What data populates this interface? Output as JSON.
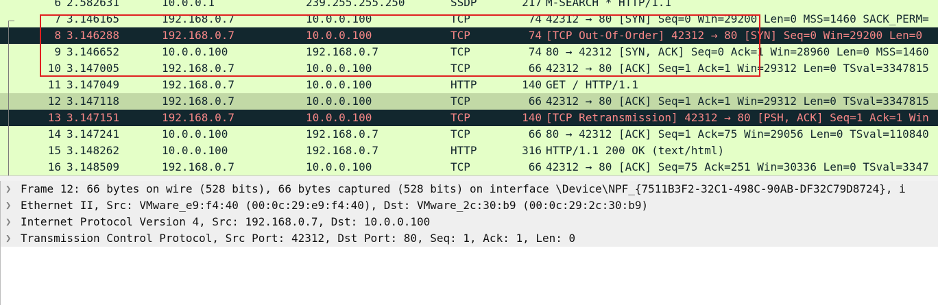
{
  "packets": [
    {
      "no": "6",
      "time": "2.582631",
      "src": "10.0.0.1",
      "dst": "239.255.255.250",
      "proto": "SSDP",
      "len": "217",
      "info": "M-SEARCH * HTTP/1.1",
      "style": "normal"
    },
    {
      "no": "7",
      "time": "3.146165",
      "src": "192.168.0.7",
      "dst": "10.0.0.100",
      "proto": "TCP",
      "len": "74",
      "info": "42312 → 80 [SYN] Seq=0 Win=29200 Len=0 MSS=1460 SACK_PERM=",
      "style": "normal"
    },
    {
      "no": "8",
      "time": "3.146288",
      "src": "192.168.0.7",
      "dst": "10.0.0.100",
      "proto": "TCP",
      "len": "74",
      "info": "[TCP Out-Of-Order] 42312 → 80 [SYN] Seq=0 Win=29200 Len=0",
      "style": "bad"
    },
    {
      "no": "9",
      "time": "3.146652",
      "src": "10.0.0.100",
      "dst": "192.168.0.7",
      "proto": "TCP",
      "len": "74",
      "info": "80 → 42312 [SYN, ACK] Seq=0 Ack=1 Win=28960 Len=0 MSS=1460",
      "style": "normal"
    },
    {
      "no": "10",
      "time": "3.147005",
      "src": "192.168.0.7",
      "dst": "10.0.0.100",
      "proto": "TCP",
      "len": "66",
      "info": "42312 → 80 [ACK] Seq=1 Ack=1 Win=29312 Len=0 TSval=3347815",
      "style": "normal"
    },
    {
      "no": "11",
      "time": "3.147049",
      "src": "192.168.0.7",
      "dst": "10.0.0.100",
      "proto": "HTTP",
      "len": "140",
      "info": "GET / HTTP/1.1",
      "style": "normal"
    },
    {
      "no": "12",
      "time": "3.147118",
      "src": "192.168.0.7",
      "dst": "10.0.0.100",
      "proto": "TCP",
      "len": "66",
      "info": "42312 → 80 [ACK] Seq=1 Ack=1 Win=29312 Len=0 TSval=3347815",
      "style": "selected"
    },
    {
      "no": "13",
      "time": "3.147151",
      "src": "192.168.0.7",
      "dst": "10.0.0.100",
      "proto": "TCP",
      "len": "140",
      "info": "[TCP Retransmission] 42312 → 80 [PSH, ACK] Seq=1 Ack=1 Win",
      "style": "bad"
    },
    {
      "no": "14",
      "time": "3.147241",
      "src": "10.0.0.100",
      "dst": "192.168.0.7",
      "proto": "TCP",
      "len": "66",
      "info": "80 → 42312 [ACK] Seq=1 Ack=75 Win=29056 Len=0 TSval=110840",
      "style": "normal"
    },
    {
      "no": "15",
      "time": "3.148262",
      "src": "10.0.0.100",
      "dst": "192.168.0.7",
      "proto": "HTTP",
      "len": "316",
      "info": "HTTP/1.1 200 OK  (text/html)",
      "style": "normal"
    },
    {
      "no": "16",
      "time": "3.148509",
      "src": "192.168.0.7",
      "dst": "10.0.0.100",
      "proto": "TCP",
      "len": "66",
      "info": "42312 → 80 [ACK] Seq=75 Ack=251 Win=30336 Len=0 TSval=3347",
      "style": "normal"
    }
  ],
  "row_colors": {
    "normal_bg": "#e4ffc7",
    "selected_bg": "#c2d9a6",
    "bad_bg": "#12272e",
    "bad_fg": "#f78787",
    "highlight_box": "#e02020"
  },
  "details": [
    {
      "label": "Frame 12: 66 bytes on wire (528 bits), 66 bytes captured (528 bits) on interface \\Device\\NPF_{7511B3F2-32C1-498C-90AB-DF32C79D8724}, i",
      "icon": "chevron-right-icon"
    },
    {
      "label": "Ethernet II, Src: VMware_e9:f4:40 (00:0c:29:e9:f4:40), Dst: VMware_2c:30:b9 (00:0c:29:2c:30:b9)",
      "icon": "chevron-right-icon"
    },
    {
      "label": "Internet Protocol Version 4, Src: 192.168.0.7, Dst: 10.0.0.100",
      "icon": "chevron-right-icon"
    },
    {
      "label": "Transmission Control Protocol, Src Port: 42312, Dst Port: 80, Seq: 1, Ack: 1, Len: 0",
      "icon": "chevron-right-icon"
    }
  ]
}
